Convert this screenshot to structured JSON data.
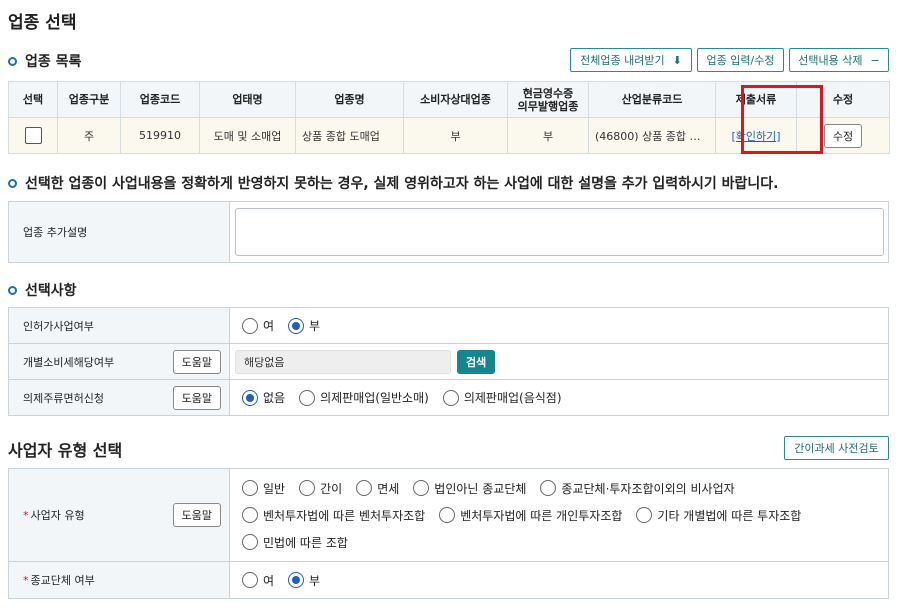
{
  "page_title": "업종 선택",
  "list_section": {
    "title": "업종 목록",
    "buttons": {
      "download_all": "전체업종 내려받기",
      "input_edit": "업종 입력/수정",
      "delete_selected": "선택내용 삭제"
    },
    "table": {
      "headers": [
        "선택",
        "업종구분",
        "업종코드",
        "업태명",
        "업종명",
        "소비자상대업종",
        "현금영수증\n의무발행업종",
        "산업분류코드",
        "제출서류",
        "수정"
      ],
      "row": {
        "type": "주",
        "code": "519910",
        "business_category": "도매 및 소매업",
        "business_name": "상품 종합 도매업",
        "consumer_facing": "부",
        "cash_receipt": "부",
        "industry_code": "(46800) 상품 종합 …",
        "documents_link": "[확인하기]",
        "edit_button": "수정"
      }
    }
  },
  "desc_section": {
    "title": "선택한 업종이 사업내용을 정확하게 반영하지 못하는 경우, 실제 영위하고자 하는 사업에 대한 설명을 추가 입력하시기 바랍니다.",
    "label": "업종 추가설명",
    "value": ""
  },
  "options_section": {
    "title": "선택사항",
    "license": {
      "label": "인허가사업여부",
      "options": [
        "여",
        "부"
      ],
      "selected": "부"
    },
    "excise": {
      "label": "개별소비세해당여부",
      "help": "도움말",
      "value": "해당없음",
      "search_button": "검색"
    },
    "liquor": {
      "label": "의제주류면허신청",
      "help": "도움말",
      "options": [
        "없음",
        "의제판매업(일반소매)",
        "의제판매업(음식점)"
      ],
      "selected": "없음"
    }
  },
  "biz_type_section": {
    "title": "사업자 유형 선택",
    "precheck_button": "간이과세 사전검토",
    "type": {
      "label": "사업자 유형",
      "help": "도움말",
      "options_line1": [
        "일반",
        "간이",
        "면세",
        "법인아닌 종교단체",
        "종교단체·투자조합이외의 비사업자"
      ],
      "options_line2": [
        "벤처투자법에 따른 벤처투자조합",
        "벤처투자법에 따른 개인투자조합",
        "기타 개별법에 따른 투자조합"
      ],
      "options_line3": [
        "민법에 따른 조합"
      ]
    },
    "religious": {
      "label": "종교단체 여부",
      "options": [
        "여",
        "부"
      ],
      "selected": "부"
    }
  },
  "colors": {
    "accent": "#13878d",
    "highlight": "#e0141c",
    "link": "#1f5fbf"
  }
}
